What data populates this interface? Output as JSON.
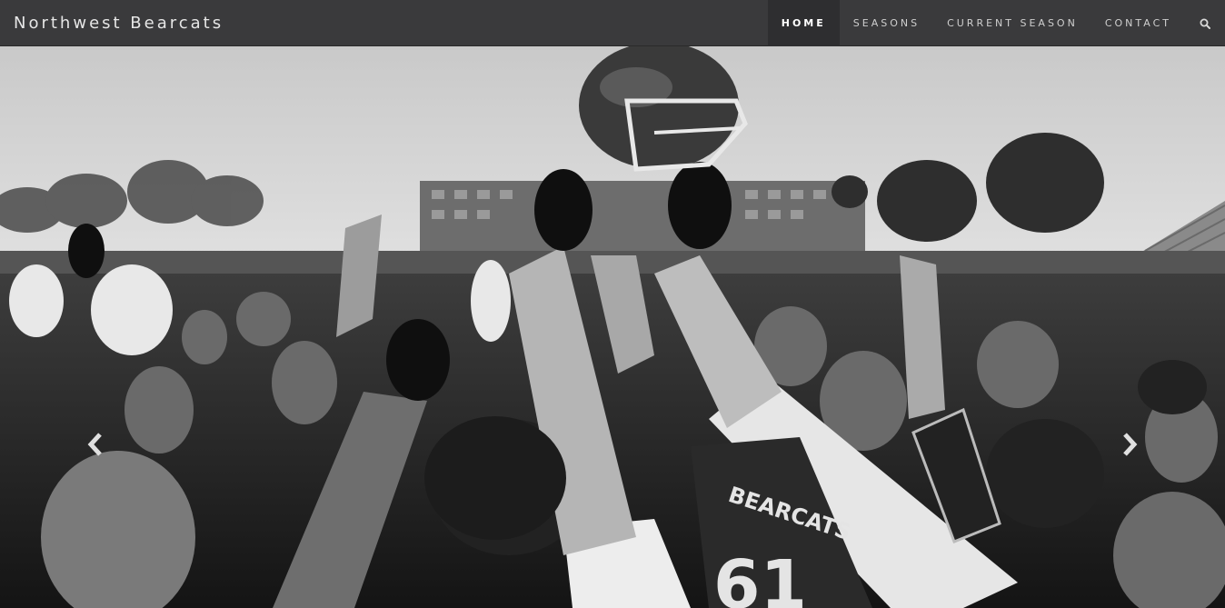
{
  "brand": {
    "name": "Northwest Bearcats"
  },
  "nav": {
    "items": [
      {
        "label": "HOME",
        "active": true
      },
      {
        "label": "SEASONS",
        "active": false
      },
      {
        "label": "CURRENT SEASON",
        "active": false
      },
      {
        "label": "CONTACT",
        "active": false
      }
    ],
    "search_icon": "search-icon"
  },
  "hero": {
    "image_description": "black and white photo of football team celebrating, raising a helmet",
    "jersey_text": "BEARCATS",
    "jersey_number": "61",
    "prev_icon": "chevron-left-icon",
    "next_icon": "chevron-right-icon"
  },
  "colors": {
    "navbar": "#3a3a3c",
    "navbar_active": "#2e2e30",
    "text": "#cfcfcf"
  }
}
